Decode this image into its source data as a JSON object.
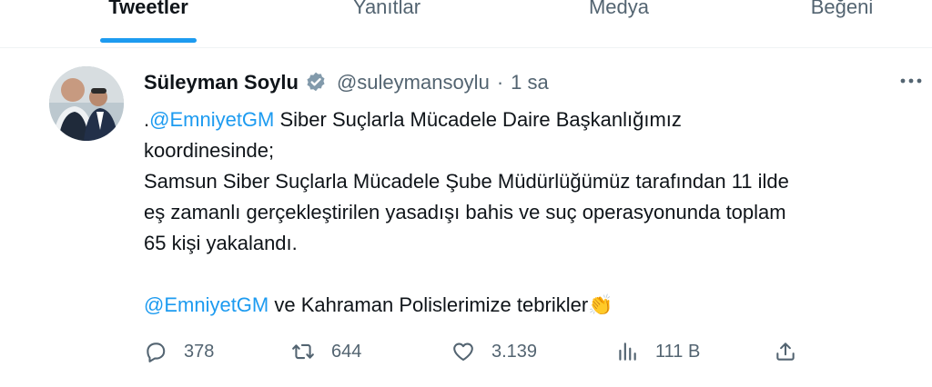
{
  "tabs": [
    {
      "label": "Tweetler",
      "active": true
    },
    {
      "label": "Yanıtlar",
      "active": false
    },
    {
      "label": "Medya",
      "active": false
    },
    {
      "label": "Beğeni",
      "active": false
    }
  ],
  "tweet": {
    "author_name": "Süleyman Soylu",
    "verified": true,
    "handle": "@suleymansoylu",
    "separator": "·",
    "time": "1 sa",
    "more_icon": "more-horizontal-icon",
    "lines": {
      "l1_prefix": ".",
      "l1_mention": "@EmniyetGM",
      "l1_rest": " Siber Suçlarla Mücadele Daire Başkanlığımız",
      "l2": "koordinesinde;",
      "l3": "Samsun Siber Suçlarla Mücadele Şube Müdürlüğümüz tarafından 11 ilde",
      "l4": "eş zamanlı gerçekleştirilen yasadışı bahis ve suç operasyonunda toplam",
      "l5": "65 kişi yakalandı.",
      "l6_mention": "@EmniyetGM",
      "l6_rest": " ve Kahraman Polislerimize tebrikler",
      "l6_emoji": "👏"
    },
    "actions": {
      "reply_count": "378",
      "retweet_count": "644",
      "like_count": "3.139",
      "views_count": "111 B"
    }
  },
  "colors": {
    "accent": "#1d9bf0",
    "secondary_text": "#536471",
    "primary_text": "#0f1419"
  }
}
